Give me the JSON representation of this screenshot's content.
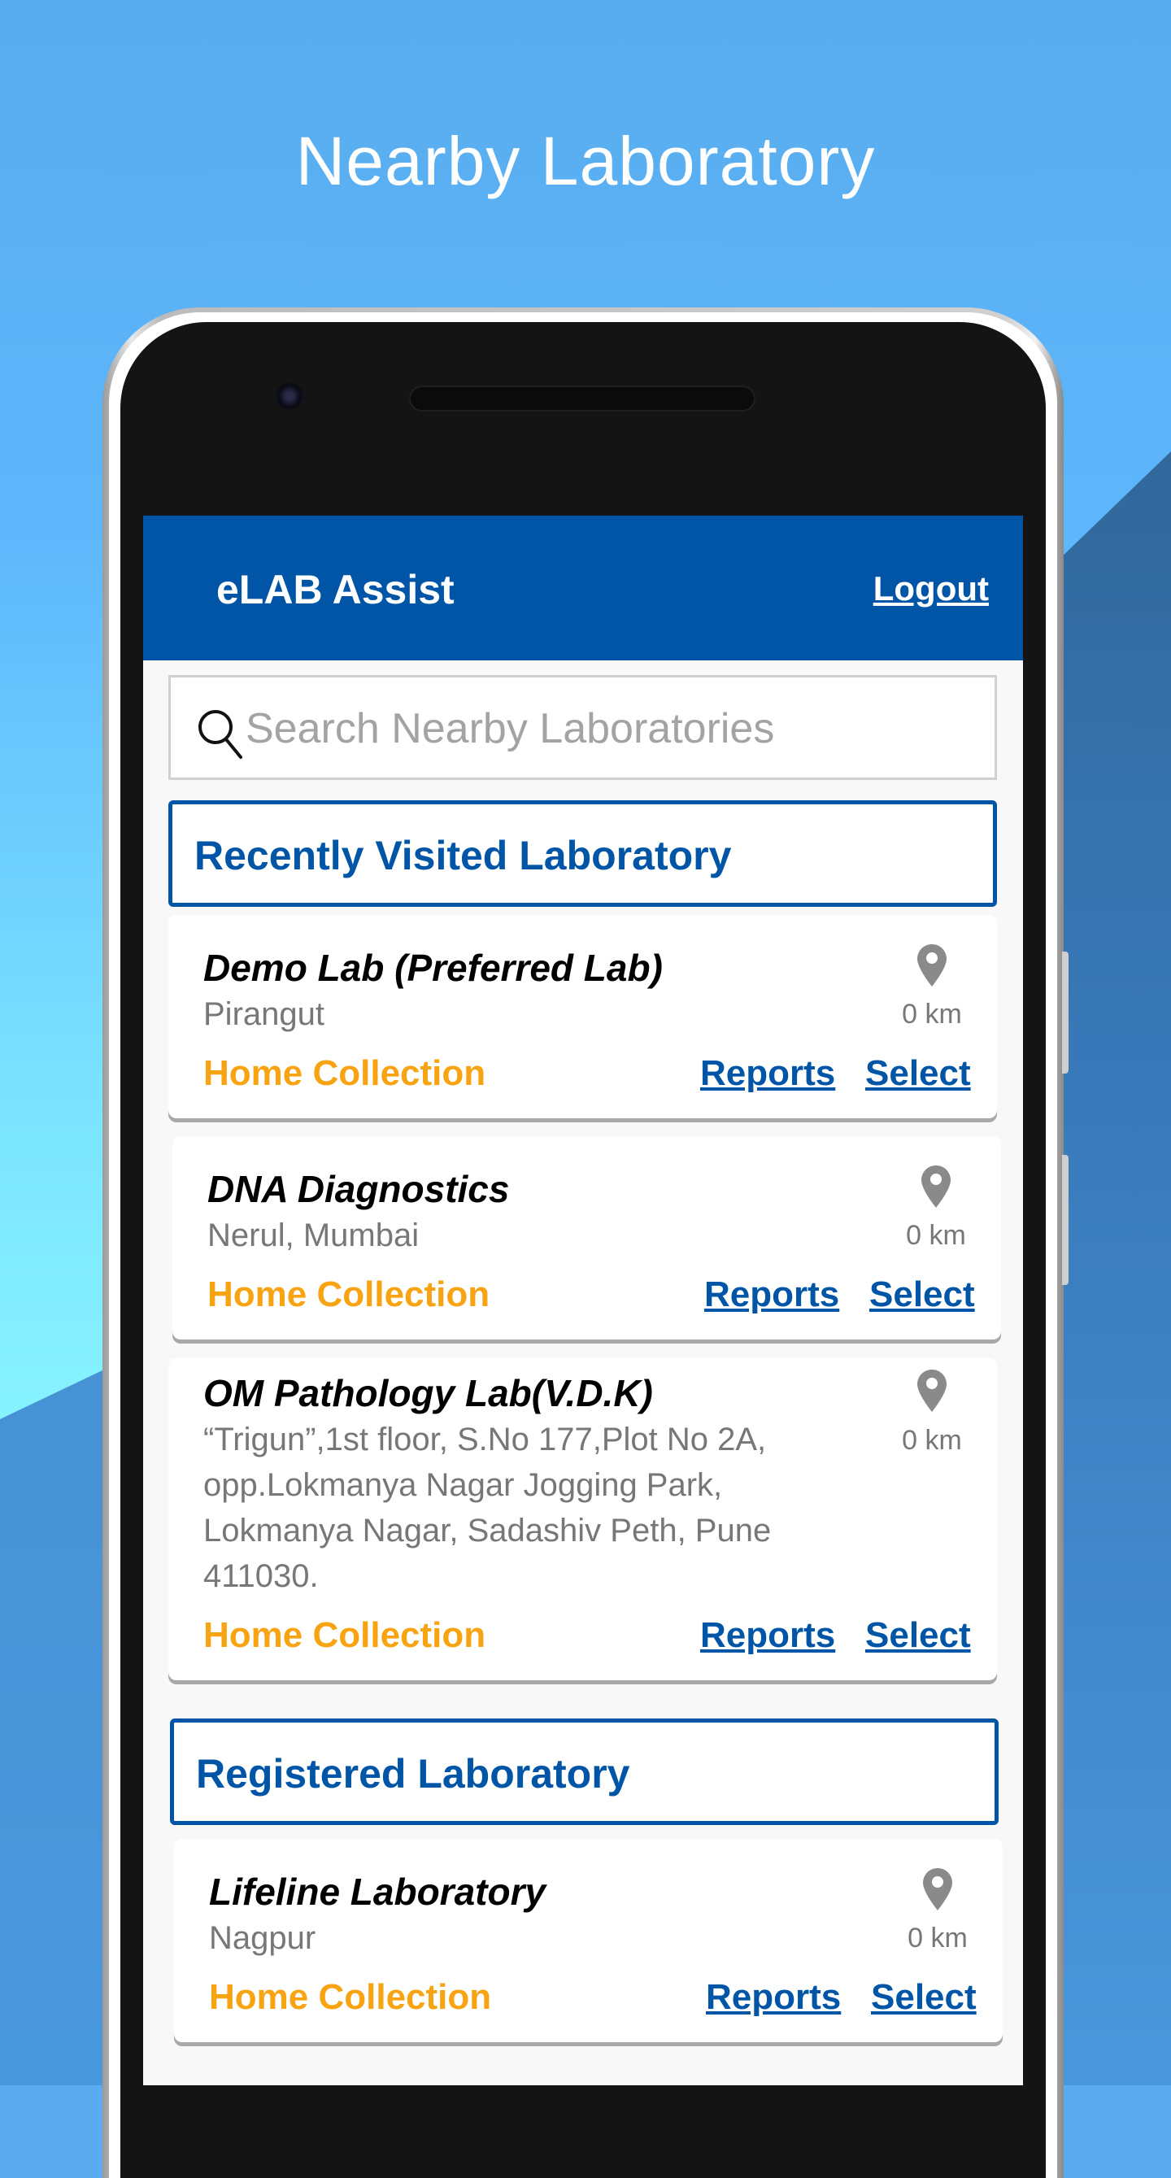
{
  "promo": {
    "title": "Nearby Laboratory"
  },
  "app": {
    "title": "eLAB Assist",
    "logout_label": "Logout"
  },
  "search": {
    "placeholder": "Search Nearby Laboratories",
    "value": "",
    "icon": "search-icon"
  },
  "sections": {
    "recent_title": "Recently Visited Laboratory",
    "registered_title": "Registered Laboratory"
  },
  "labs": [
    {
      "name": "Demo Lab (Preferred Lab)",
      "address": "Pirangut",
      "distance": "0 km",
      "home_collection": "Home Collection",
      "reports_label": "Reports",
      "select_label": "Select",
      "icon": "location-pin-icon"
    },
    {
      "name": "DNA Diagnostics",
      "address": "Nerul, Mumbai",
      "distance": "0 km",
      "home_collection": "Home Collection",
      "reports_label": "Reports",
      "select_label": "Select",
      "icon": "location-pin-icon"
    },
    {
      "name": "OM Pathology Lab(V.D.K)",
      "address": "“Trigun”,1st floor, S.No 177,Plot No 2A, opp.Lokmanya Nagar Jogging Park, Lokmanya Nagar, Sadashiv Peth, Pune 411030.",
      "distance": "0 km",
      "home_collection": "Home Collection",
      "reports_label": "Reports",
      "select_label": "Select",
      "icon": "location-pin-icon"
    },
    {
      "name": "Lifeline Laboratory",
      "address": "Nagpur",
      "distance": "0 km",
      "home_collection": "Home Collection",
      "reports_label": "Reports",
      "select_label": "Select",
      "icon": "location-pin-icon"
    }
  ],
  "colors": {
    "brand_blue": "#0055a6",
    "home_collection_orange": "#f7a312",
    "muted_text": "#777777"
  }
}
